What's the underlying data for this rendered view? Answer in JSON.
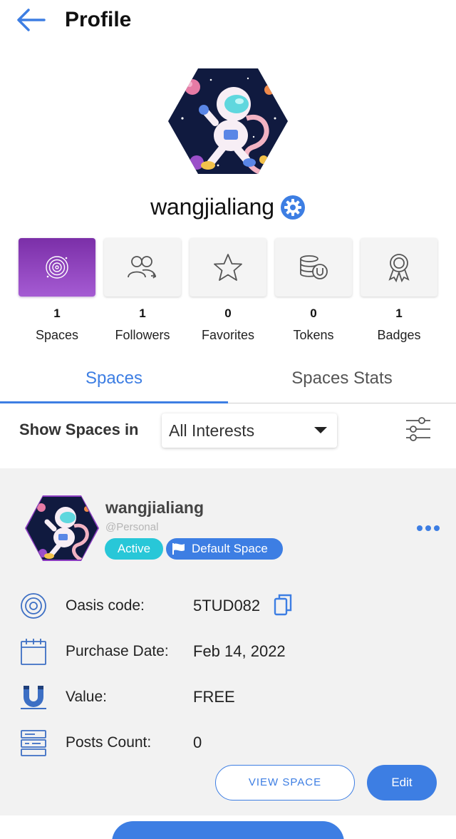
{
  "header": {
    "title": "Profile"
  },
  "profile": {
    "username": "wangjialiang"
  },
  "stats": [
    {
      "count": "1",
      "label": "Spaces",
      "icon": "space-icon",
      "active": true
    },
    {
      "count": "1",
      "label": "Followers",
      "icon": "followers-icon",
      "active": false
    },
    {
      "count": "0",
      "label": "Favorites",
      "icon": "star-icon",
      "active": false
    },
    {
      "count": "0",
      "label": "Tokens",
      "icon": "tokens-icon",
      "active": false
    },
    {
      "count": "1",
      "label": "Badges",
      "icon": "badge-icon",
      "active": false
    }
  ],
  "tabs": [
    {
      "label": "Spaces",
      "active": true
    },
    {
      "label": "Spaces Stats",
      "active": false
    }
  ],
  "filter": {
    "label": "Show Spaces in",
    "selected": "All Interests"
  },
  "card": {
    "name": "wangjialiang",
    "handle": "@Personal",
    "status_badge": "Active",
    "default_badge": "Default Space",
    "rows": [
      {
        "label": "Oasis code:",
        "value": "5TUD082",
        "icon": "oasis-icon"
      },
      {
        "label": "Purchase Date:",
        "value": "Feb 14, 2022",
        "icon": "calendar-icon"
      },
      {
        "label": "Value:",
        "value": "FREE",
        "icon": "magnet-icon"
      },
      {
        "label": "Posts Count:",
        "value": "0",
        "icon": "posts-icon"
      }
    ],
    "view_button": "VIEW SPACE",
    "edit_button": "Edit"
  },
  "colors": {
    "accent": "#3d7ee3",
    "active_badge": "#28c7d8",
    "tile_active": "#8a3cc0",
    "card_bg": "#f2f2f2"
  }
}
